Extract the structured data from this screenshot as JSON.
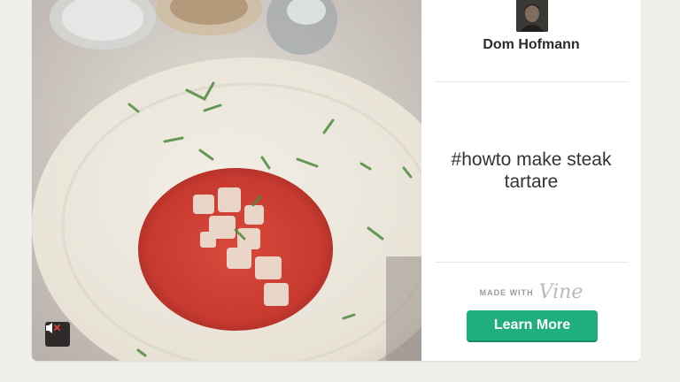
{
  "author": {
    "name": "Dom Hofmann"
  },
  "post": {
    "caption": "#howto make steak tartare"
  },
  "branding": {
    "made_with": "MADE WITH",
    "vine": "Vine"
  },
  "actions": {
    "learn_more": "Learn More"
  },
  "video": {
    "icon": "speaker-muted-icon"
  },
  "colors": {
    "accent": "#1fae7e",
    "background": "#f0efeb"
  }
}
